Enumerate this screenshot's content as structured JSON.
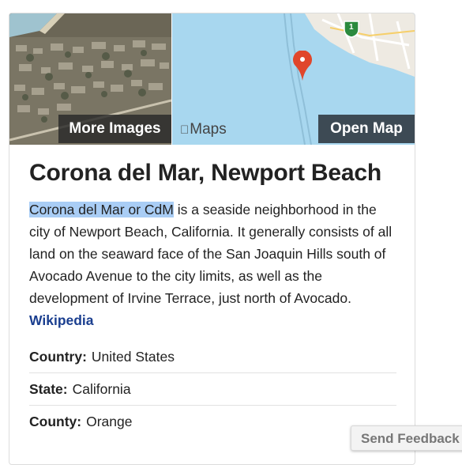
{
  "media": {
    "more_images_label": "More Images",
    "maps_logo_label": "Maps",
    "open_map_label": "Open Map",
    "route_shield": "1"
  },
  "place": {
    "title": "Corona del Mar, Newport Beach",
    "desc_highlight": "Corona del Mar or CdM",
    "desc_rest": " is a seaside neighborhood in the city of Newport Beach, California. It generally consists of all land on the seaward face of the San Joaquin Hills south of Avocado Avenue to the city limits, as well as the development of Irvine Terrace, just north of Avocado. ",
    "source_link": "Wikipedia"
  },
  "facts": [
    {
      "key": "Country:",
      "value": "United States"
    },
    {
      "key": "State:",
      "value": "California"
    },
    {
      "key": "County:",
      "value": "Orange"
    }
  ],
  "feedback_label": "Send Feedback",
  "colors": {
    "highlight": "#a9cdf5",
    "link": "#1a3e8f",
    "water": "#a8d7ef",
    "pin": "#e0462b"
  }
}
